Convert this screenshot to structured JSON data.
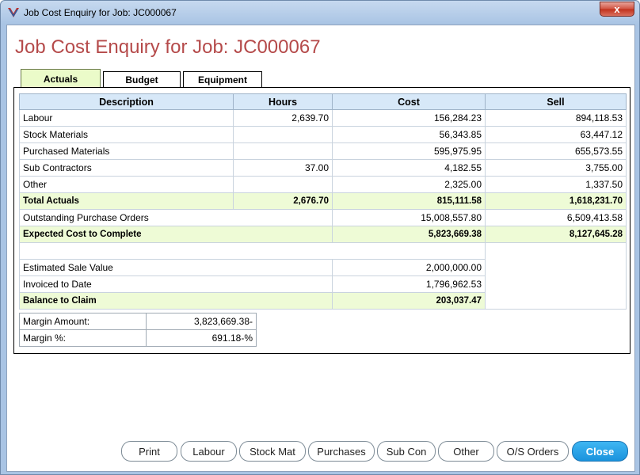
{
  "window": {
    "title": "Job Cost Enquiry for Job: JC000067",
    "close_glyph": "x"
  },
  "heading": "Job Cost Enquiry for Job: JC000067",
  "tabs": [
    {
      "label": "Actuals",
      "active": true
    },
    {
      "label": "Budget",
      "active": false
    },
    {
      "label": "Equipment",
      "active": false
    }
  ],
  "table": {
    "columns": [
      "Description",
      "Hours",
      "Cost",
      "Sell"
    ],
    "rows": [
      {
        "description": "Labour",
        "hours": "2,639.70",
        "cost": "156,284.23",
        "sell": "894,118.53"
      },
      {
        "description": "Stock Materials",
        "hours": "",
        "cost": "56,343.85",
        "sell": "63,447.12"
      },
      {
        "description": "Purchased Materials",
        "hours": "",
        "cost": "595,975.95",
        "sell": "655,573.55"
      },
      {
        "description": "Sub Contractors",
        "hours": "37.00",
        "cost": "4,182.55",
        "sell": "3,755.00"
      },
      {
        "description": "Other",
        "hours": "",
        "cost": "2,325.00",
        "sell": "1,337.50"
      }
    ],
    "total_actuals": {
      "description": "Total Actuals",
      "hours": "2,676.70",
      "cost": "815,111.58",
      "sell": "1,618,231.70"
    },
    "outstanding_po": {
      "description": "Outstanding Purchase Orders",
      "cost": "15,008,557.80",
      "sell": "6,509,413.58"
    },
    "expected_cost": {
      "description": "Expected Cost to Complete",
      "cost": "5,823,669.38",
      "sell": "8,127,645.28"
    },
    "estimated_sale": {
      "description": "Estimated Sale Value",
      "value": "2,000,000.00"
    },
    "invoiced": {
      "description": "Invoiced to Date",
      "value": "1,796,962.53"
    },
    "balance": {
      "description": "Balance to Claim",
      "value": "203,037.47"
    }
  },
  "margin": {
    "amount_label": "Margin Amount:",
    "amount_value": "3,823,669.38-",
    "percent_label": "Margin %:",
    "percent_value": "691.18-%"
  },
  "buttons": {
    "print": "Print",
    "labour": "Labour",
    "stock_mat": "Stock Mat",
    "purchases": "Purchases",
    "sub_con": "Sub Con",
    "other": "Other",
    "os_orders": "O/S Orders",
    "close": "Close"
  },
  "colors": {
    "heading": "#b54a4a",
    "active_tab": "#ebfbc9",
    "header_row": "#d7e8f8",
    "total_row": "#eefbd6",
    "primary_button": "#1a93dd"
  }
}
